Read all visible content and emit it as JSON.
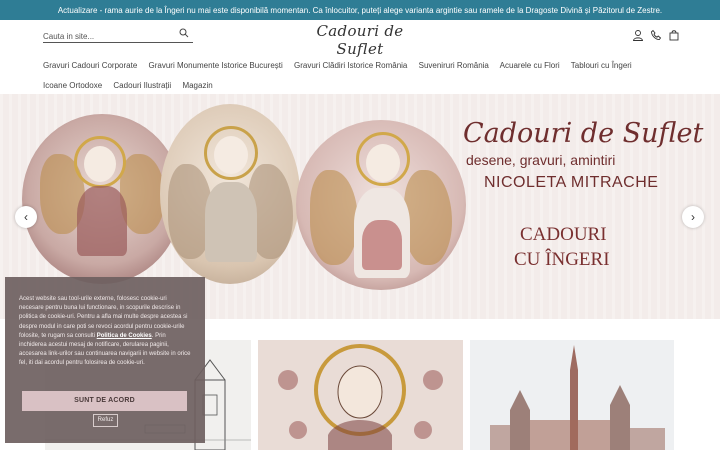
{
  "announcement": "Actualizare - rama aurie de la Îngeri nu mai este disponibilă momentan. Ca înlocuitor, puteți alege varianta argintie sau ramele de la Dragoste Divină și Păzitorul de Zestre.",
  "header": {
    "search_placeholder": "Cauta in site...",
    "logo": "Cadouri de Suflet",
    "icons": [
      "account-icon",
      "phone-icon",
      "cart-icon"
    ]
  },
  "nav": {
    "items": [
      "Gravuri Cadouri Corporate",
      "Gravuri Monumente Istorice București",
      "Gravuri Clădiri Istorice România",
      "Suveniruri România",
      "Acuarele cu Flori",
      "Tablouri cu Îngeri",
      "Icoane Ortodoxe",
      "Cadouri Ilustrații",
      "Magazin"
    ]
  },
  "hero": {
    "title": "Cadouri de Suflet",
    "subtitle": "desene, gravuri, amintiri",
    "artist": "NICOLETA MITRACHE",
    "cta_line1": "CADOURI",
    "cta_line2": "CU ÎNGERI",
    "prev": "‹",
    "next": "›"
  },
  "cookie": {
    "text_before": "Acest website sau tool-urile externe, folosesc cookie-uri necesare pentru buna lui functionare, in scopurile descrise in politica de cookie-uri. Pentru a afla mai multe despre acestea si despre modul in care poti se revoci acordul pentru cookie-urile folosite, te rugam sa consulti ",
    "link": "Politica de Cookies",
    "text_after": ". Prin inchiderea acestui mesaj de notificare, derularea paginii, accesarea link-urilor sau continuarea navigarii in website in orice fel, iti dai acordul pentru folosirea de cookie-uri.",
    "accept": "SUNT DE ACORD",
    "reject": "Refuz"
  },
  "colors": {
    "announcement_bg": "#2f7d95",
    "brand": "#6f2e2e",
    "cookie_bg": "#6e6060",
    "accept_bg": "#d9c1c4"
  }
}
